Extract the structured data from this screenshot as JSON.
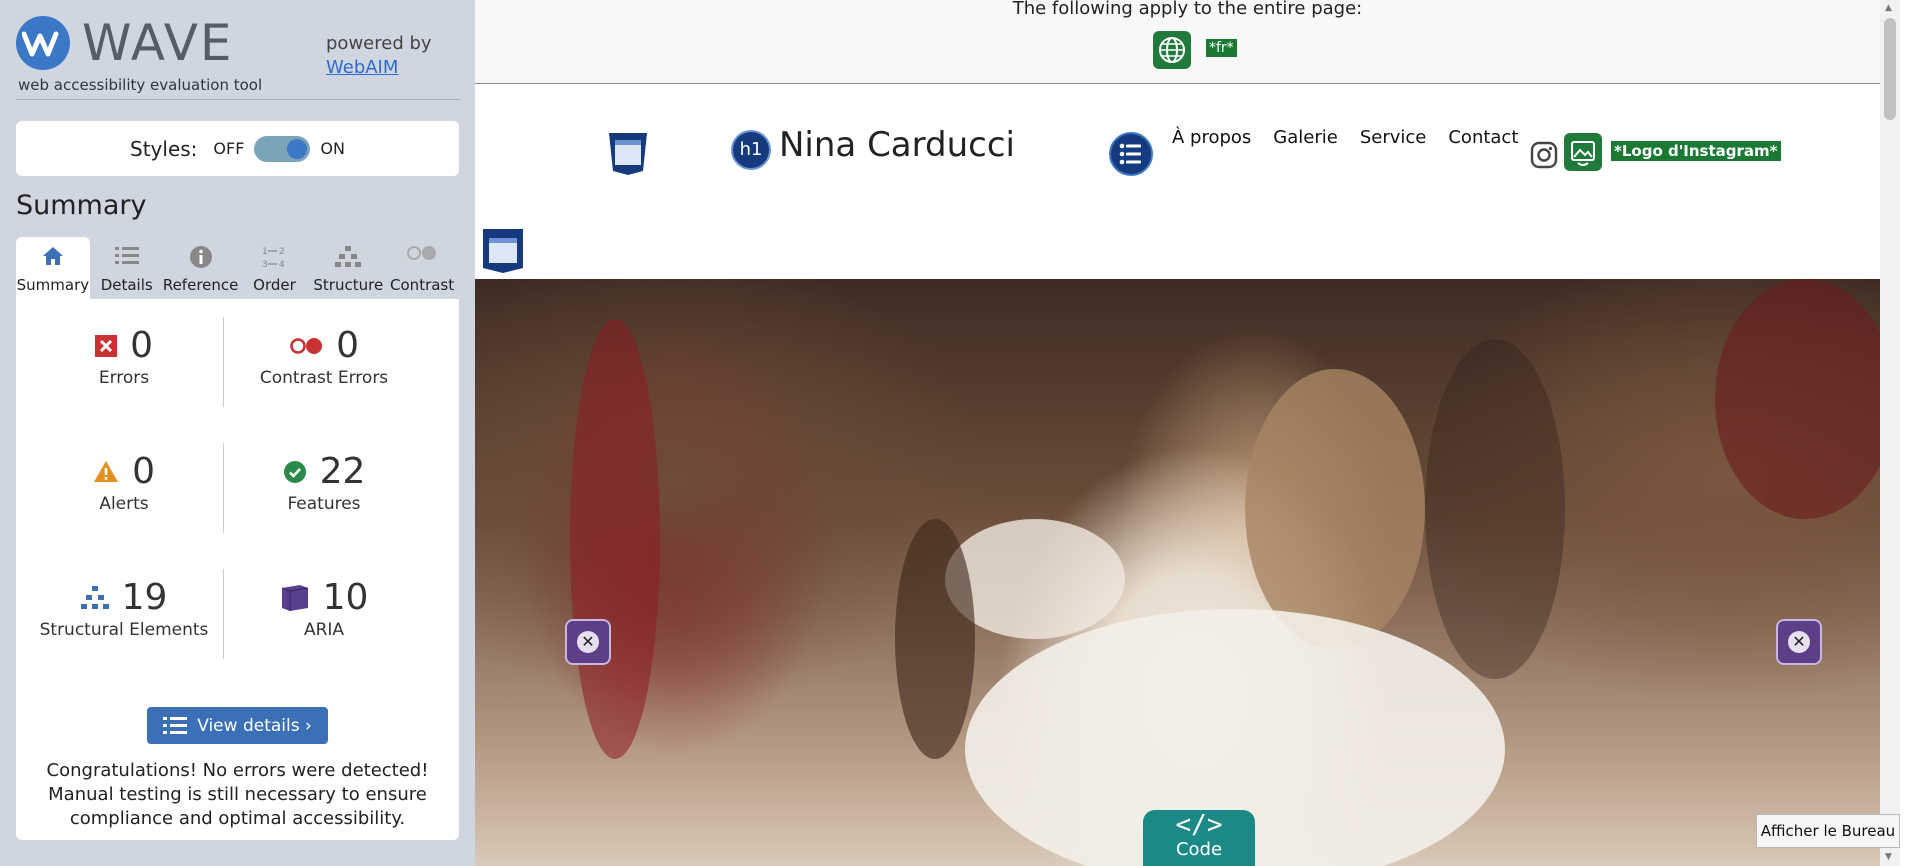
{
  "sidebar": {
    "brand_name": "WAVE",
    "tagline": "web accessibility evaluation tool",
    "powered_by": "powered by",
    "powered_link": "WebAIM",
    "styles_label": "Styles:",
    "styles_off": "OFF",
    "styles_on": "ON",
    "styles_state": "on",
    "summary_title": "Summary",
    "tabs": [
      {
        "label": "Summary",
        "icon": "home-icon",
        "active": true
      },
      {
        "label": "Details",
        "icon": "list-icon",
        "active": false
      },
      {
        "label": "Reference",
        "icon": "info-icon",
        "active": false
      },
      {
        "label": "Order",
        "icon": "order-icon",
        "active": false
      },
      {
        "label": "Structure",
        "icon": "structure-icon",
        "active": false
      },
      {
        "label": "Contrast",
        "icon": "contrast-icon",
        "active": false
      }
    ],
    "stats": [
      {
        "count": "0",
        "label": "Errors",
        "icon": "error-icon",
        "color": "#c83232"
      },
      {
        "count": "0",
        "label": "Contrast Errors",
        "icon": "contrast-error-icon",
        "color": "#c83232"
      },
      {
        "count": "0",
        "label": "Alerts",
        "icon": "alert-icon",
        "color": "#e5901e"
      },
      {
        "count": "22",
        "label": "Features",
        "icon": "feature-icon",
        "color": "#2a8a4a"
      },
      {
        "count": "19",
        "label": "Structural Elements",
        "icon": "structure-icon",
        "color": "#3b6fb6"
      },
      {
        "count": "10",
        "label": "ARIA",
        "icon": "aria-icon",
        "color": "#5a3f8e"
      }
    ],
    "view_details": "View details ›",
    "congrats": "Congratulations! No errors were detected! Manual testing is still necessary to ensure compliance and optimal accessibility."
  },
  "page": {
    "notice": "The following apply to the entire page:",
    "lang_tag": "*fr*",
    "site_title": "Nina Carducci",
    "h1_badge": "h1",
    "nav": [
      "À propos",
      "Galerie",
      "Service",
      "Contact"
    ],
    "instagram_alt": "*Logo d'Instagram*",
    "code_symbol": "</>",
    "code_label": "Code",
    "tooltip": "Afficher le Bureau"
  },
  "colors": {
    "accent": "#3b78c5",
    "sidebar_bg": "#cfd6e0",
    "feature_green": "#1f7a3b",
    "aria_purple": "#5d3f88",
    "code_teal": "#1b8a86"
  }
}
